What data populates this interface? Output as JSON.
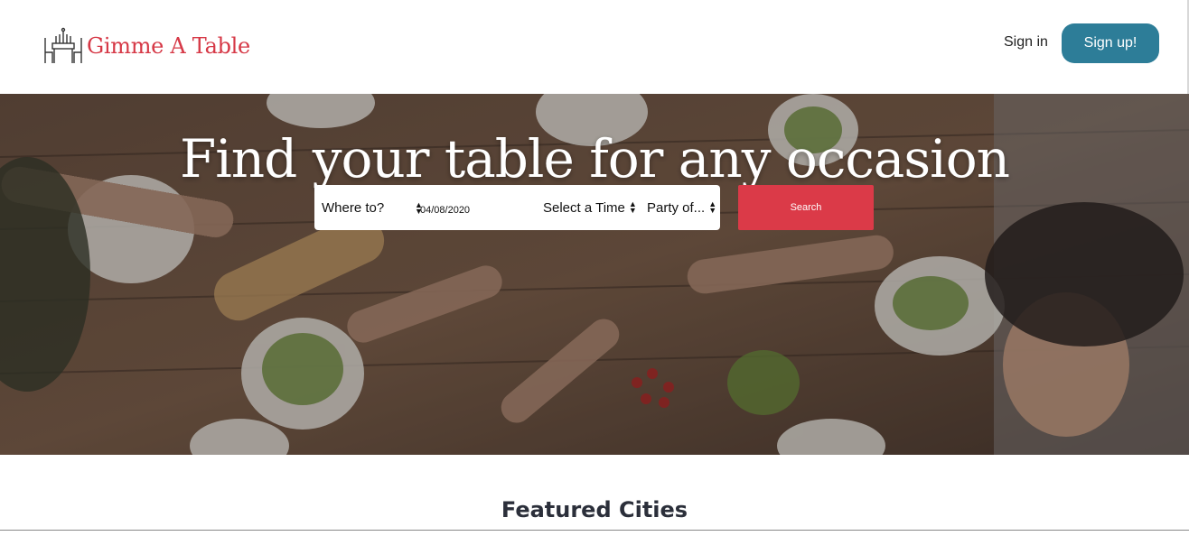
{
  "header": {
    "logo_text": "Gimme A Table",
    "logo_icon": "dining-table-icon",
    "signin_label": "Sign in",
    "signup_label": "Sign up!"
  },
  "hero": {
    "title": "Find your table for any occasion",
    "background": "overhead-dinner-table-photo"
  },
  "search": {
    "where_label": "Where to?",
    "date_value": "04/08/2020",
    "time_label": "Select a Time",
    "party_label": "Party of...",
    "button_label": "Search"
  },
  "featured": {
    "heading": "Featured Cities"
  },
  "colors": {
    "brand_red": "#d63846",
    "signup_blue": "#2d7d98",
    "search_red": "#db3a48",
    "heading_dark": "#2b2f3a"
  }
}
